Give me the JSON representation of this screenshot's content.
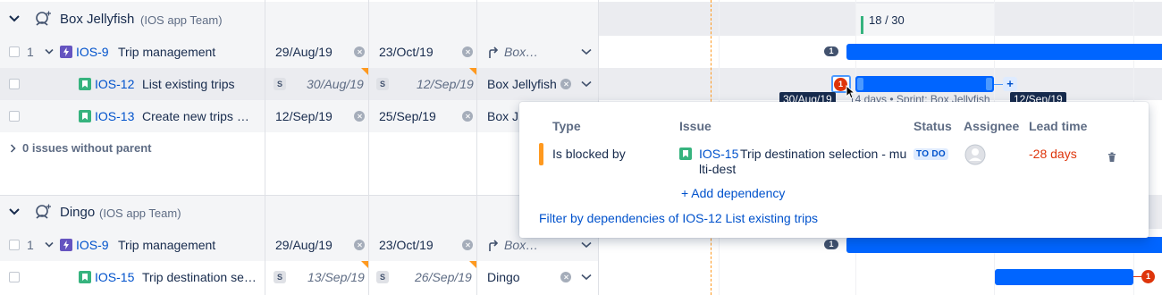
{
  "groups": [
    {
      "team_name": "Box Jellyfish",
      "team_sub": "(IOS app Team)",
      "capacity": "18 / 30",
      "rows": [
        {
          "rank": "1",
          "key": "IOS-9",
          "summary": "Trip management",
          "start": "29/Aug/19",
          "end": "23/Oct/19",
          "team": "Box…"
        },
        {
          "rank": "",
          "key": "IOS-12",
          "summary": "List existing trips",
          "start": "30/Aug/19",
          "end": "12/Sep/19",
          "team": "Box Jellyfish"
        },
        {
          "rank": "",
          "key": "IOS-13",
          "summary": "Create new trips …",
          "start": "12/Sep/19",
          "end": "25/Sep/19",
          "team": "Box J"
        }
      ],
      "without_parent": "0 issues without parent"
    },
    {
      "team_name": "Dingo",
      "team_sub": "(IOS app Team)",
      "rows": [
        {
          "rank": "1",
          "key": "IOS-9",
          "summary": "Trip management",
          "start": "29/Aug/19",
          "end": "23/Oct/19",
          "team": "Box…"
        },
        {
          "rank": "",
          "key": "IOS-15",
          "summary": "Trip destination se…",
          "start": "13/Sep/19",
          "end": "26/Sep/19",
          "team": "Dingo"
        }
      ]
    }
  ],
  "sprint_badge": "S",
  "timeline": {
    "count_badges": [
      "1",
      "1"
    ],
    "dependency_count": "1",
    "dingo_dependency_count": "1",
    "hover_start": "30/Aug/19",
    "hover_sprint": "14 days • Sprint: Box Jellyfish",
    "hover_end": "12/Sep/19",
    "add_plus": "+"
  },
  "popup": {
    "headers": {
      "type": "Type",
      "issue": "Issue",
      "status": "Status",
      "assignee": "Assignee",
      "lead_time": "Lead time"
    },
    "row": {
      "type": "Is blocked by",
      "key": "IOS-15",
      "summary_line1": "Trip destination selection - mu",
      "summary_line2": "lti-dest",
      "status": "TO DO",
      "lead_time": "-28 days"
    },
    "add_dependency": "+ Add dependency",
    "filter_link": "Filter by dependencies of IOS-12 List existing trips"
  },
  "colors": {
    "accent": "#0065ff",
    "link": "#0052cc",
    "danger": "#de350b",
    "warning": "#ff991f",
    "success": "#36b37e"
  }
}
